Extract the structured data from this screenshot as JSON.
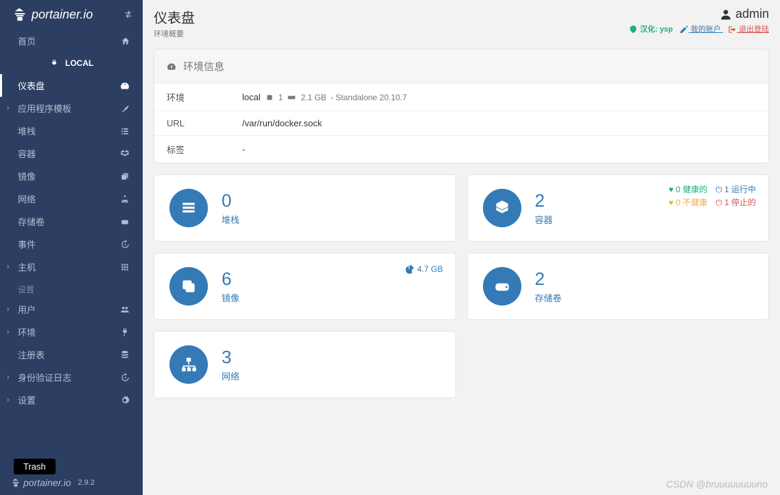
{
  "brand": "portainer.io",
  "version": "2.9.2",
  "sidebar": {
    "home": "首页",
    "section": "LOCAL",
    "items": [
      {
        "label": "仪表盘",
        "icon": "tachometer",
        "active": true
      },
      {
        "label": "应用程序模板",
        "icon": "rocket",
        "caret": true
      },
      {
        "label": "堆栈",
        "icon": "list"
      },
      {
        "label": "容器",
        "icon": "cubes"
      },
      {
        "label": "镜像",
        "icon": "clone"
      },
      {
        "label": "网络",
        "icon": "sitemap"
      },
      {
        "label": "存储卷",
        "icon": "hdd"
      },
      {
        "label": "事件",
        "icon": "history"
      },
      {
        "label": "主机",
        "icon": "th",
        "caret": true
      }
    ],
    "settings_heading": "设置",
    "settings": [
      {
        "label": "用户",
        "icon": "users",
        "caret": true
      },
      {
        "label": "环境",
        "icon": "plug",
        "caret": true
      },
      {
        "label": "注册表",
        "icon": "database"
      },
      {
        "label": "身份验证日志",
        "icon": "history",
        "caret": true
      },
      {
        "label": "设置",
        "icon": "cogs",
        "caret": true
      }
    ]
  },
  "header": {
    "title": "仪表盘",
    "subtitle": "环境概要",
    "user": "admin",
    "hanhua_label": "汉化:",
    "hanhua_by": "ysp",
    "my_account": "我的账户",
    "logout": "退出登陆"
  },
  "env_info": {
    "title": "环境信息",
    "rows": {
      "env_label": "环境",
      "env_name": "local",
      "cpu": "1",
      "ram": "2.1 GB",
      "standalone": "- Standalone 20.10.7",
      "url_label": "URL",
      "url_value": "/var/run/docker.sock",
      "tags_label": "标签",
      "tags_value": "-"
    }
  },
  "cards": {
    "stacks": {
      "count": "0",
      "label": "堆栈"
    },
    "containers": {
      "count": "2",
      "label": "容器",
      "healthy": "0 健康的",
      "running": "1 运行中",
      "unhealthy": "0 不健康",
      "stopped": "1 停止的"
    },
    "images": {
      "count": "6",
      "label": "镜像",
      "size": "4.7 GB"
    },
    "volumes": {
      "count": "2",
      "label": "存储卷"
    },
    "networks": {
      "count": "3",
      "label": "网络"
    }
  },
  "trash_tooltip": "Trash",
  "watermark": "CSDN @bruuuuuuuuno"
}
